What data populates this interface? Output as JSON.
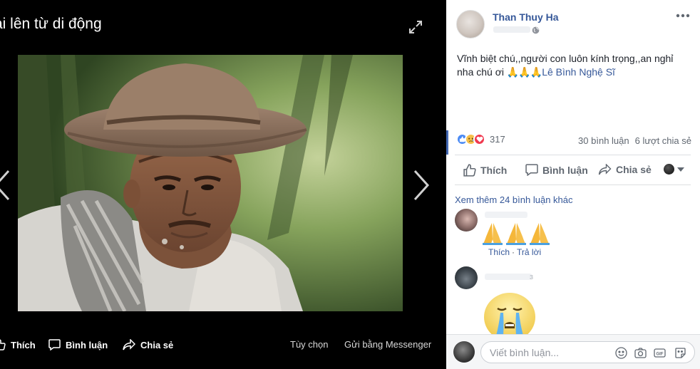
{
  "viewer": {
    "album_title": "ải lên từ di động",
    "actions": {
      "like": "Thích",
      "comment": "Bình luận",
      "share": "Chia sẻ",
      "options": "Tùy chọn",
      "messenger": "Gửi bằng Messenger"
    }
  },
  "post": {
    "author": "Than Thuy Ha",
    "text": "Vĩnh biệt chú,,người con luôn kính trọng,,an nghỉ nha chú ơi ",
    "pray_emojis": "🙏🙏🙏",
    "tagged_page": "Lê Bình Nghệ Sĩ",
    "reaction_count": "317",
    "comment_count": "30 bình luận",
    "share_count": "6 lượt chia sẻ",
    "actions": {
      "like": "Thích",
      "comment": "Bình luận",
      "share": "Chia sẻ"
    }
  },
  "comments": {
    "more_comments": "Xem thêm 24 bình luận khác",
    "items": [
      {
        "reply_actions": {
          "like": "Thích",
          "separator": "·",
          "reply": "Trả lời"
        }
      },
      {
        "name_fragment": "ɜ"
      }
    ]
  },
  "composer": {
    "placeholder": "Viết bình luận..."
  },
  "colors": {
    "link_blue": "#365899",
    "facebook_blue": "#4267b2",
    "muted_text": "#606770"
  }
}
